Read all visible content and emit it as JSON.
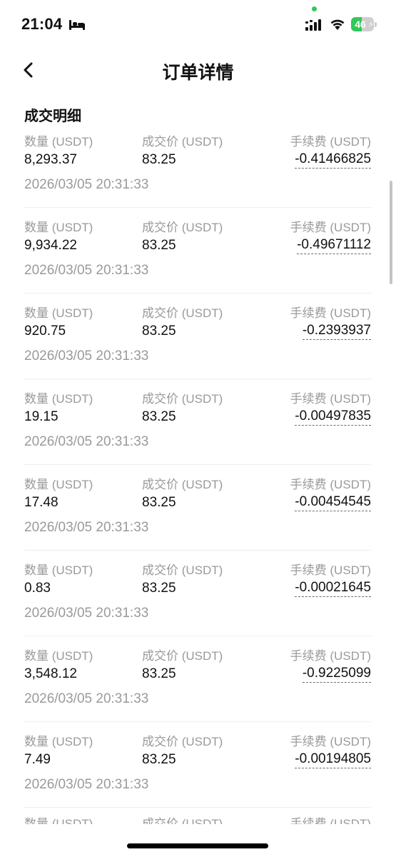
{
  "status_bar": {
    "time": "21:04",
    "battery_level": "46",
    "battery_charging": true,
    "icons": [
      "bed-icon",
      "signal-icon",
      "wifi-icon",
      "battery-icon"
    ],
    "accent_color": "#34c759"
  },
  "header": {
    "title": "订单详情",
    "back_icon": "chevron-left-icon"
  },
  "section": {
    "title": "成交明细"
  },
  "labels": {
    "quantity": "数量 (USDT)",
    "price": "成交价 (USDT)",
    "fee": "手续费 (USDT)"
  },
  "trades": [
    {
      "quantity": "8,293.37",
      "price": "83.25",
      "fee": "-0.41466825",
      "time": "2026/03/05 20:31:33"
    },
    {
      "quantity": "9,934.22",
      "price": "83.25",
      "fee": "-0.49671112",
      "time": "2026/03/05 20:31:33"
    },
    {
      "quantity": "920.75",
      "price": "83.25",
      "fee": "-0.2393937",
      "time": "2026/03/05 20:31:33"
    },
    {
      "quantity": "19.15",
      "price": "83.25",
      "fee": "-0.00497835",
      "time": "2026/03/05 20:31:33"
    },
    {
      "quantity": "17.48",
      "price": "83.25",
      "fee": "-0.00454545",
      "time": "2026/03/05 20:31:33"
    },
    {
      "quantity": "0.83",
      "price": "83.25",
      "fee": "-0.00021645",
      "time": "2026/03/05 20:31:33"
    },
    {
      "quantity": "3,548.12",
      "price": "83.25",
      "fee": "-0.9225099",
      "time": "2026/03/05 20:31:33"
    },
    {
      "quantity": "7.49",
      "price": "83.25",
      "fee": "-0.00194805",
      "time": "2026/03/05 20:31:33"
    }
  ]
}
